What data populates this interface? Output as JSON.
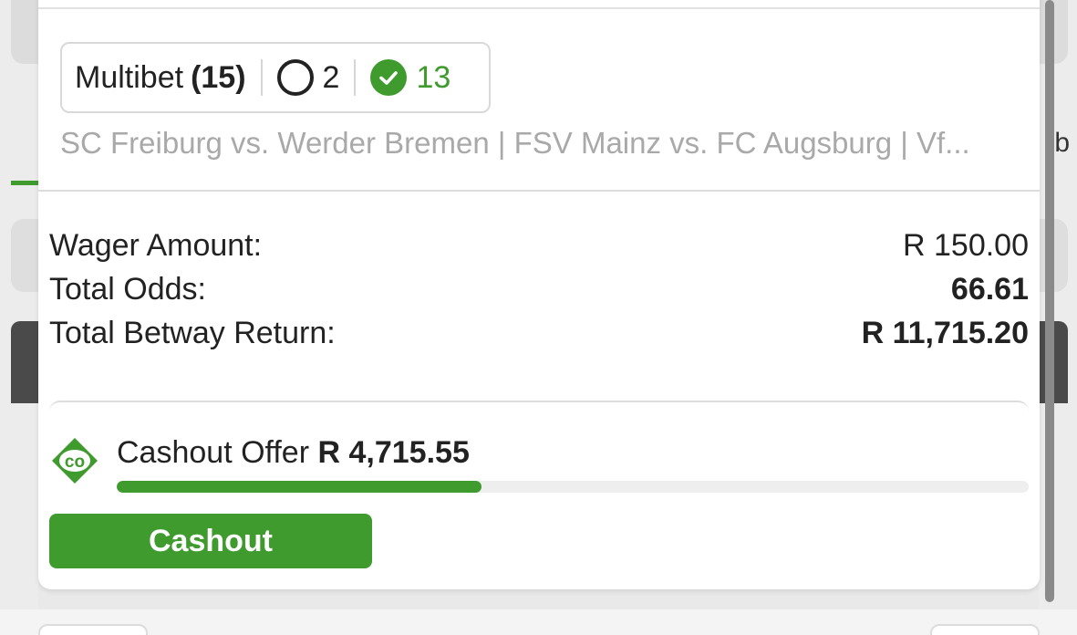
{
  "bet": {
    "type_label": "Multibet",
    "leg_count": "(15)",
    "open_count": "2",
    "won_count": "13",
    "matches": "SC Freiburg vs. Werder Bremen | FSV Mainz vs. FC Augsburg | Vf..."
  },
  "details": {
    "wager_label": "Wager Amount:",
    "wager_value": "R 150.00",
    "odds_label": "Total Odds:",
    "odds_value": "66.61",
    "return_label": "Total Betway Return:",
    "return_value": "R 11,715.20"
  },
  "cashout": {
    "offer_label": "Cashout Offer",
    "offer_amount": "R 4,715.55",
    "progress_fraction": 0.4,
    "button_label": "Cashout"
  },
  "background": {
    "right_fragment": "b"
  },
  "colors": {
    "accent_green": "#3f9b2e",
    "muted_text": "#a9a9a9"
  },
  "icons": [
    "circle-open-icon",
    "check-circle-icon",
    "cashout-logo-icon"
  ]
}
